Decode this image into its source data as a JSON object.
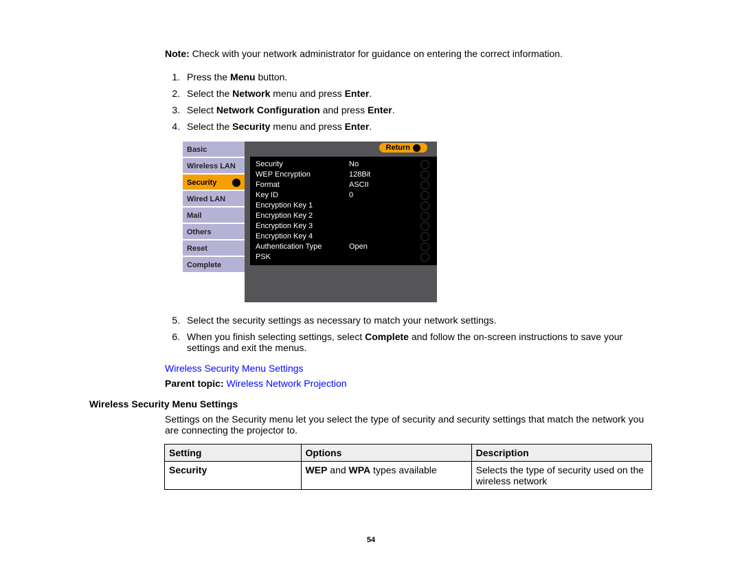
{
  "note": {
    "prefix": "Note:",
    "text": " Check with your network administrator for guidance on entering the correct information."
  },
  "steps": {
    "s1a": "Press the ",
    "s1b": "Menu",
    "s1c": " button.",
    "s2a": "Select the ",
    "s2b": "Network",
    "s2c": " menu and press ",
    "s2d": "Enter",
    "s2e": ".",
    "s3a": "Select ",
    "s3b": "Network Configuration",
    "s3c": " and press ",
    "s3d": "Enter",
    "s3e": ".",
    "s4a": "Select the ",
    "s4b": "Security",
    "s4c": " menu and press ",
    "s4d": "Enter",
    "s4e": ".",
    "s5": "Select the security settings as necessary to match your network settings.",
    "s6a": "When you finish selecting settings, select ",
    "s6b": "Complete",
    "s6c": " and follow the on-screen instructions to save your settings and exit the menus."
  },
  "projector": {
    "tabs": [
      "Basic",
      "Wireless LAN",
      "Security",
      "Wired LAN",
      "Mail",
      "Others",
      "Reset",
      "Complete"
    ],
    "selected_tab_index": 2,
    "return": "Return",
    "rows": [
      {
        "label": "Security",
        "value": "No"
      },
      {
        "label": "WEP Encryption",
        "value": "128Bit"
      },
      {
        "label": "Format",
        "value": "ASCII"
      },
      {
        "label": "Key ID",
        "value": "0"
      },
      {
        "label": "Encryption Key 1",
        "value": ""
      },
      {
        "label": "Encryption Key 2",
        "value": ""
      },
      {
        "label": "Encryption Key 3",
        "value": ""
      },
      {
        "label": "Encryption Key 4",
        "value": ""
      },
      {
        "label": "Authentication Type",
        "value": "Open"
      },
      {
        "label": "PSK",
        "value": ""
      }
    ]
  },
  "links": {
    "wireless_security": "Wireless Security Menu Settings",
    "parent_prefix": "Parent topic:",
    "parent_link": " Wireless Network Projection"
  },
  "section": {
    "heading": "Wireless Security Menu Settings",
    "desc": "Settings on the Security menu let you select the type of security and security settings that match the network you are connecting the projector to."
  },
  "table": {
    "headers": [
      "Setting",
      "Options",
      "Description"
    ],
    "row1": {
      "setting": "Security",
      "opt_b1": "WEP",
      "opt_mid": " and ",
      "opt_b2": "WPA",
      "opt_tail": " types available",
      "desc": "Selects the type of security used on the wireless network"
    }
  },
  "page_number": "54"
}
